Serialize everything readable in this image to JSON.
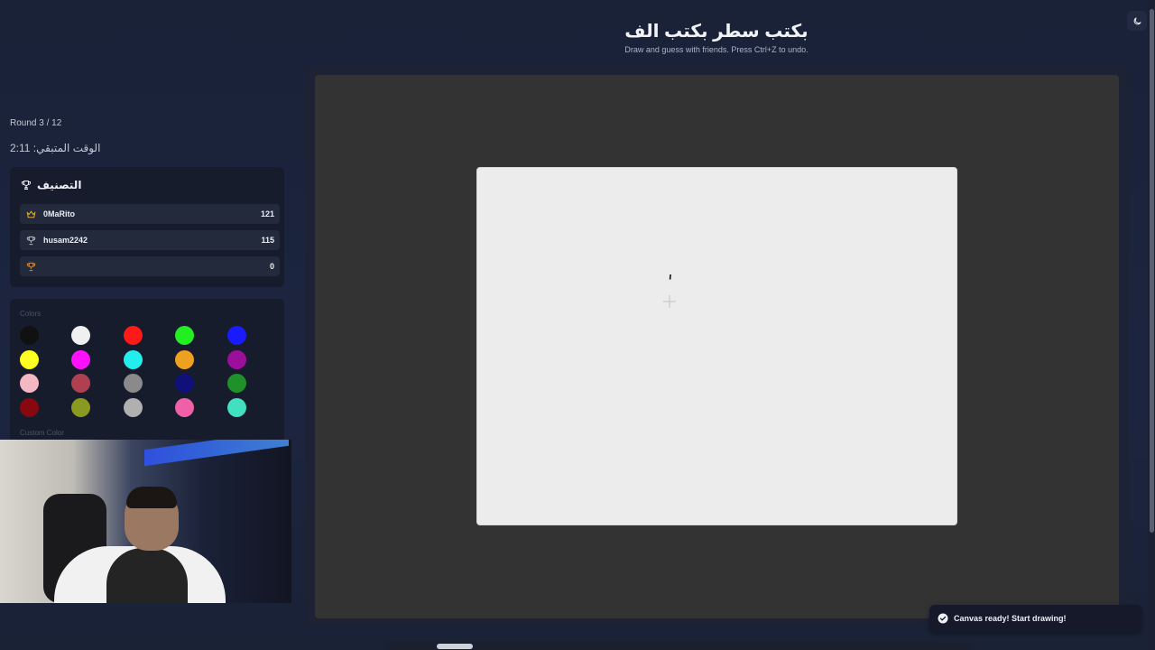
{
  "header": {
    "title": "بكتب سطر بكتب الف",
    "subtitle": "Draw and guess with friends. Press Ctrl+Z to undo."
  },
  "game": {
    "round": "Round 3 / 12",
    "timer": "الوقت المتبقي: 2:11"
  },
  "leaderboard": {
    "title": "التصنيف",
    "players": [
      {
        "name": "0MaRito",
        "score": "121",
        "icon": "crown-icon"
      },
      {
        "name": "husam2242",
        "score": "115",
        "icon": "trophy-icon"
      },
      {
        "name": "",
        "score": "0",
        "icon": "medal-icon"
      }
    ]
  },
  "colors": {
    "label": "Colors",
    "custom_label": "Custom Color",
    "palette": [
      "#111111",
      "#f0f0f0",
      "#ff1a1a",
      "#22ee22",
      "#1a1aff",
      "#ffff22",
      "#ff10ff",
      "#22eeee",
      "#eea020",
      "#9a109a",
      "#f4b8c4",
      "#b04050",
      "#8a8a8a",
      "#10107a",
      "#20902a",
      "#880810",
      "#8a9a20",
      "#b0b0b0",
      "#f060a8",
      "#40e0c0"
    ]
  },
  "toast": {
    "message": "Canvas ready! Start drawing!"
  },
  "icons": {
    "theme": "moon-icon",
    "toast": "check-circle-icon",
    "cursor": "crosshair-icon"
  }
}
